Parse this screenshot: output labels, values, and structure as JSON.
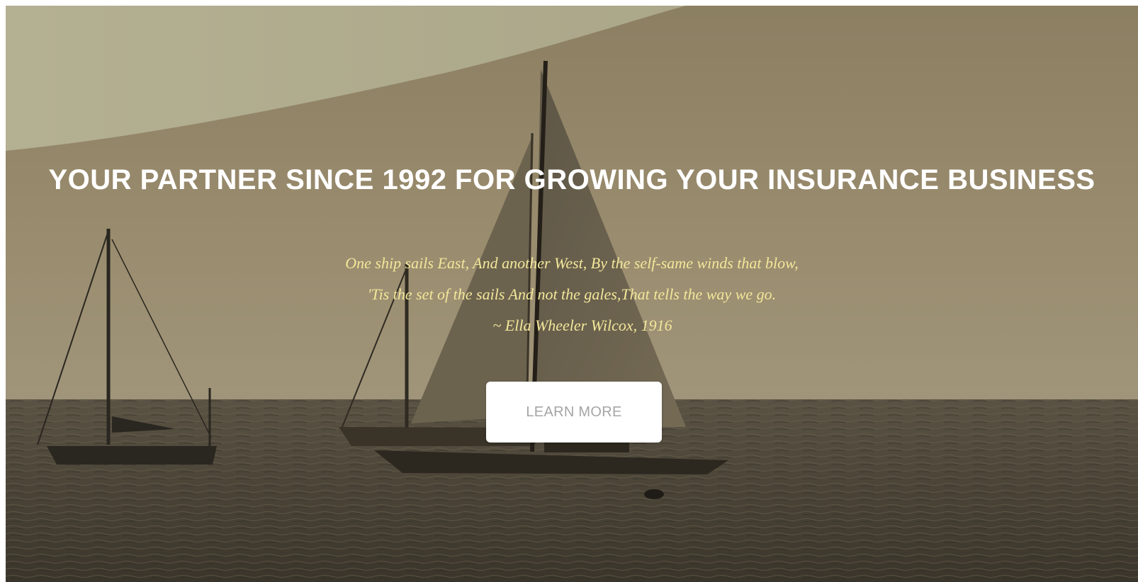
{
  "hero": {
    "background": "sepia-sailboats-photo",
    "headline": "YOUR PARTNER SINCE 1992 FOR GROWING YOUR INSURANCE BUSINESS",
    "quote_lines": [
      "One ship sails East, And another West, By the self-same winds that blow,",
      "'Tis the set of the sails And not the gales,That tells the way we go."
    ],
    "attribution": "~ Ella Wheeler Wilcox, 1916",
    "cta_label": "LEARN MORE"
  },
  "colors": {
    "headline": "#ffffff",
    "quote": "#f3e79a",
    "cta_background": "#ffffff",
    "cta_text": "#a5a5a5"
  }
}
